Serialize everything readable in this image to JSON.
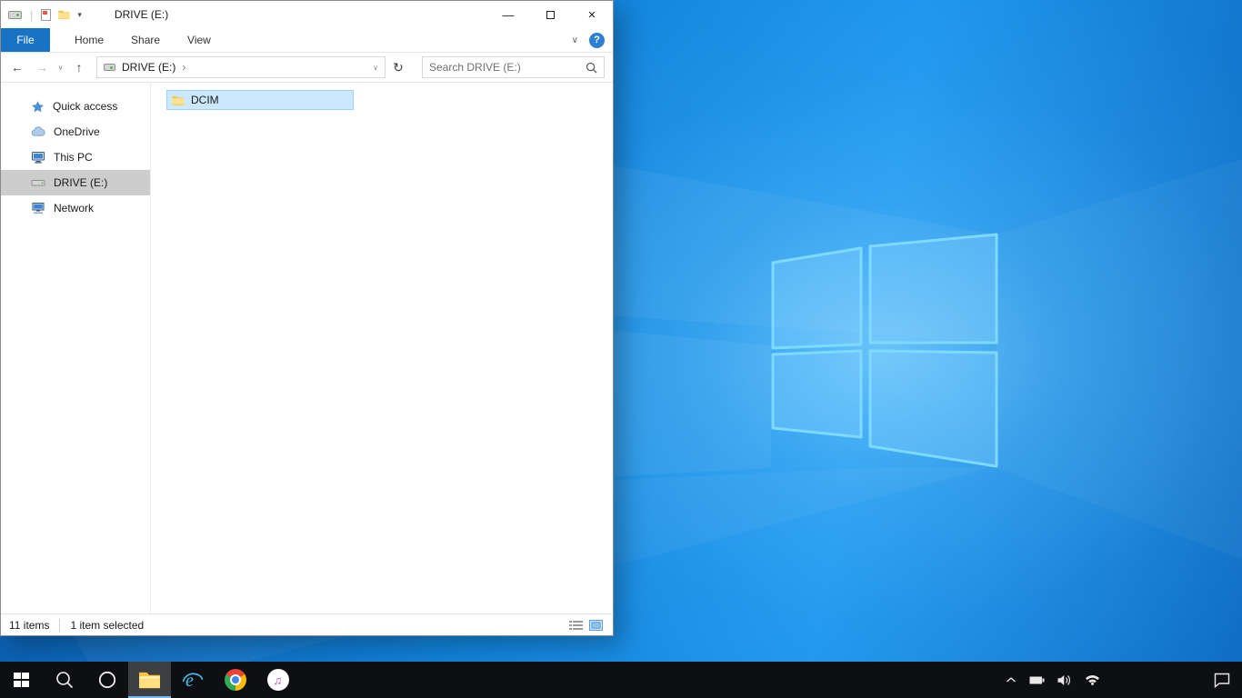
{
  "glyphs": {
    "back": "←",
    "forward": "→",
    "up": "↑",
    "refresh": "↻",
    "dropdown": "∨",
    "chevron_right": "›",
    "qat_dropdown": "▾",
    "ribbon_collapse": "∨",
    "help": "?",
    "minimize": "—",
    "close": "×",
    "itunes_note": "♫"
  },
  "explorer": {
    "title": "DRIVE (E:)",
    "ribbon": {
      "file": "File",
      "tabs": [
        {
          "label": "Home"
        },
        {
          "label": "Share"
        },
        {
          "label": "View"
        }
      ]
    },
    "address": {
      "crumb": "DRIVE (E:)"
    },
    "search": {
      "placeholder": "Search DRIVE (E:)"
    },
    "sidebar": [
      {
        "label": "Quick access",
        "icon": "star-icon"
      },
      {
        "label": "OneDrive",
        "icon": "cloud-icon"
      },
      {
        "label": "This PC",
        "icon": "computer-icon"
      },
      {
        "label": "DRIVE (E:)",
        "icon": "drive-icon",
        "selected": true
      },
      {
        "label": "Network",
        "icon": "network-icon"
      }
    ],
    "files": [
      {
        "name": "DCIM",
        "icon": "folder-icon",
        "selected": true
      }
    ],
    "status": {
      "count": "11 items",
      "selected": "1 item selected"
    }
  },
  "taskbar": {
    "apps": [
      {
        "name": "start"
      },
      {
        "name": "search"
      },
      {
        "name": "cortana"
      },
      {
        "name": "file-explorer",
        "active": true
      },
      {
        "name": "internet-explorer"
      },
      {
        "name": "chrome"
      },
      {
        "name": "itunes"
      }
    ],
    "tray": [
      {
        "name": "hidden-icons-chevron"
      },
      {
        "name": "battery"
      },
      {
        "name": "volume"
      },
      {
        "name": "network"
      }
    ],
    "corner": [
      {
        "name": "action-center"
      }
    ]
  },
  "colors": {
    "accent": "#1973c4",
    "selection": "#cce8ff",
    "selection_border": "#99d1ff",
    "sidebar_selected": "#cdcdcd",
    "taskbar": "#0e0f12"
  }
}
